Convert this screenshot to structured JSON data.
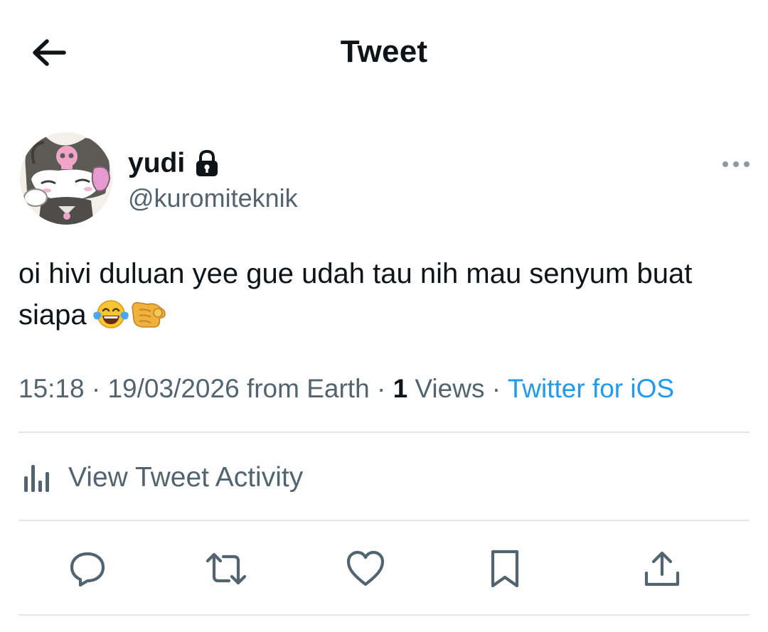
{
  "header": {
    "title": "Tweet"
  },
  "author": {
    "display_name": "yudi",
    "handle": "@kuromiteknik"
  },
  "tweet": {
    "text": "oi hivi duluan yee gue udah tau nih mau senyum buat siapa",
    "emojis": [
      "face-with-tears-of-joy-emoji",
      "backhand-index-pointing-at-viewer-emoji"
    ]
  },
  "meta": {
    "time": "15:18",
    "separator": "·",
    "date_location": "19/03/2026 from Earth",
    "views_count": "1",
    "views_label": "Views",
    "source": "Twitter for iOS"
  },
  "activity": {
    "label": "View Tweet Activity"
  },
  "actions": [
    "reply-icon",
    "retweet-icon",
    "like-icon",
    "bookmark-icon",
    "share-icon"
  ],
  "colors": {
    "text_primary": "#0f1419",
    "text_secondary": "#536471",
    "link": "#1d9bf0",
    "divider": "#e3e7ea"
  }
}
